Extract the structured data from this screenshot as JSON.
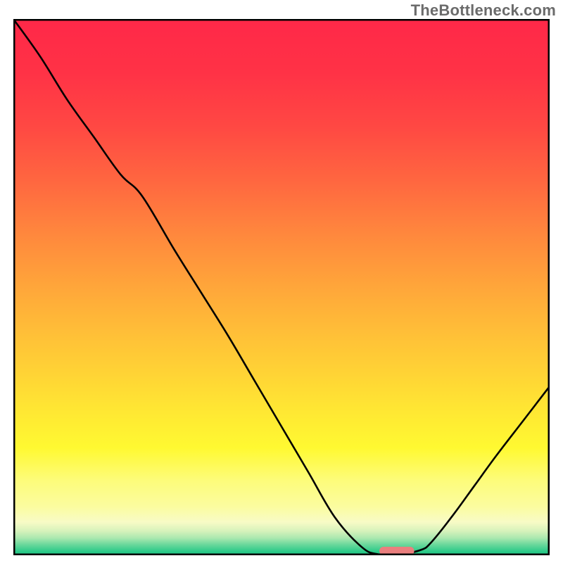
{
  "watermark": "TheBottleneck.com",
  "chart_data": {
    "type": "line",
    "title": "",
    "xlabel": "",
    "ylabel": "",
    "xlim": [
      0,
      100
    ],
    "ylim": [
      0,
      100
    ],
    "background_gradient_stops": [
      {
        "offset": 0.0,
        "color": "#ff2848"
      },
      {
        "offset": 0.1,
        "color": "#ff3246"
      },
      {
        "offset": 0.2,
        "color": "#ff4843"
      },
      {
        "offset": 0.3,
        "color": "#ff6640"
      },
      {
        "offset": 0.4,
        "color": "#ff873d"
      },
      {
        "offset": 0.5,
        "color": "#ffa63a"
      },
      {
        "offset": 0.6,
        "color": "#ffc337"
      },
      {
        "offset": 0.66,
        "color": "#ffd335"
      },
      {
        "offset": 0.73,
        "color": "#ffe733"
      },
      {
        "offset": 0.8,
        "color": "#fff931"
      },
      {
        "offset": 0.86,
        "color": "#fdfc7a"
      },
      {
        "offset": 0.91,
        "color": "#fbfca0"
      },
      {
        "offset": 0.938,
        "color": "#f8fbc6"
      },
      {
        "offset": 0.955,
        "color": "#d6f2bb"
      },
      {
        "offset": 0.968,
        "color": "#aae8af"
      },
      {
        "offset": 0.98,
        "color": "#6ad89c"
      },
      {
        "offset": 0.994,
        "color": "#28c987"
      },
      {
        "offset": 1.0,
        "color": "#28c987"
      }
    ],
    "series": [
      {
        "name": "bottleneck-curve",
        "x": [
          0,
          5,
          10,
          15,
          20,
          24,
          30,
          35,
          40,
          45,
          50,
          55,
          60,
          65,
          68,
          72,
          76,
          78,
          82,
          86,
          90,
          95,
          100
        ],
        "y": [
          100,
          93,
          85,
          78,
          71,
          67,
          57,
          49,
          41,
          32.5,
          24,
          15.5,
          7,
          1.5,
          0.2,
          0.2,
          1.0,
          2.5,
          7.5,
          13,
          18.5,
          25,
          31.5
        ]
      }
    ],
    "marker": {
      "name": "optimal-range",
      "x_center": 71.5,
      "y": 0.8,
      "width": 6.5,
      "color": "#ea7f7e"
    },
    "axes": {
      "frame_color": "#000000",
      "frame_width": 2.5
    }
  }
}
